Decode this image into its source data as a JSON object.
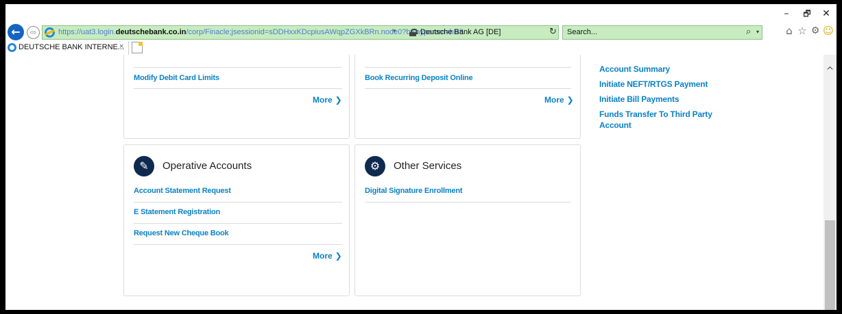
{
  "window": {
    "minimize": "–",
    "maximize": "🗗",
    "close": "✕"
  },
  "addressbar": {
    "back": "←",
    "forward": "⇨",
    "url_prefix": "https://uat3.login.",
    "url_domain": "deutschebank.co.in",
    "url_path": "/corp/Finacle;jsessionid=sDDHxxKDcpiusAWqpZGXkBRn.node0?bwayparam=hR8",
    "dropdown": "▾",
    "certificate": "Deutsche Bank AG [DE]",
    "refresh": "↻"
  },
  "search": {
    "placeholder": "Search...",
    "icon": "⌕",
    "dropdown": "▾"
  },
  "toolbar_icons": {
    "home": "⌂",
    "favorites": "☆",
    "settings": "⚙",
    "smiley": "☺"
  },
  "tab": {
    "title": "DEUTSCHE BANK INTERNE...",
    "close": "×"
  },
  "cards": {
    "top_left": {
      "link": "Modify Debit Card Limits",
      "more": "More",
      "chevron": "❯"
    },
    "top_middle": {
      "link": "Book Recurring Deposit Online",
      "more": "More",
      "chevron": "❯"
    },
    "operative": {
      "title": "Operative Accounts",
      "icon": "✎",
      "links": [
        "Account Statement Request",
        "E Statement Registration",
        "Request New Cheque Book"
      ],
      "more": "More",
      "chevron": "❯"
    },
    "other": {
      "title": "Other Services",
      "icon": "⚙",
      "links": [
        "Digital Signature Enrollment"
      ]
    }
  },
  "quick_links": [
    "Account Summary",
    "Initiate NEFT/RTGS Payment",
    "Initiate Bill Payments",
    "Funds Transfer To Third Party",
    "Account"
  ],
  "scrollbar": {
    "up_arrow": "^"
  },
  "colors": {
    "link": "#0b82c4",
    "icon_bg": "#0f2a4e",
    "address_bg": "#c7ecc0"
  }
}
